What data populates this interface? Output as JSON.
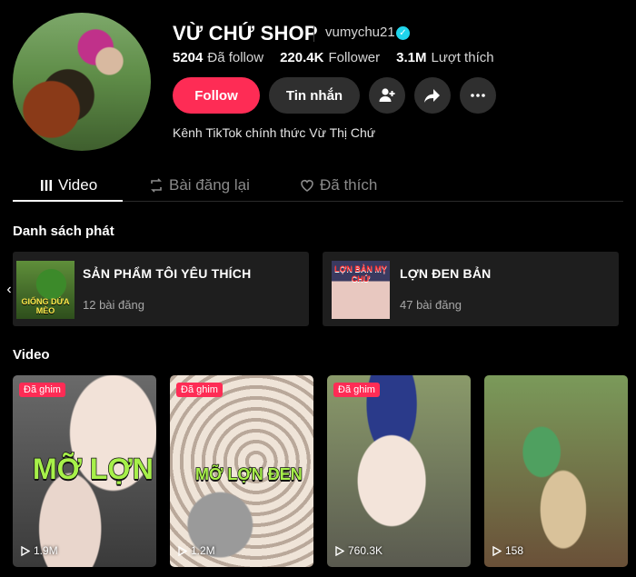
{
  "profile": {
    "username": "VỪ CHỨ SHOP",
    "handle": "vumychu21",
    "stats": [
      {
        "value": "5204",
        "label": "Đã follow"
      },
      {
        "value": "220.4K",
        "label": "Follower"
      },
      {
        "value": "3.1M",
        "label": "Lượt thích"
      }
    ],
    "follow_label": "Follow",
    "message_label": "Tin nhắn",
    "bio": "Kênh TikTok chính thức Vừ Thị Chứ"
  },
  "tabs": [
    {
      "label": "Video",
      "icon": "grid-icon"
    },
    {
      "label": "Bài đăng lại",
      "icon": "repost-icon"
    },
    {
      "label": "Đã thích",
      "icon": "liked-heart-icon"
    }
  ],
  "playlists_section": {
    "title": "Danh sách phát",
    "items": [
      {
        "title": "SẢN PHẨM TÔI YÊU THÍCH",
        "count": "12 bài đăng",
        "thumb_text": "GIỐNG DỨA MÈO"
      },
      {
        "title": "LỢN ĐEN BẢN",
        "count": "47 bài đăng",
        "thumb_text": "LỢN BẢN MỴ CHỨ"
      }
    ]
  },
  "videos_section": {
    "title": "Video",
    "items": [
      {
        "pinned": "Đã ghim",
        "views": "1.9M",
        "overlay": "MỠ LỢN"
      },
      {
        "pinned": "Đã ghim",
        "views": "1.2M",
        "overlay": "MỠ LỢN ĐEN"
      },
      {
        "pinned": "Đã ghim",
        "views": "760.3K",
        "overlay": ""
      },
      {
        "pinned": "",
        "views": "158",
        "overlay": ""
      }
    ]
  },
  "colors": {
    "accent": "#fe2c55",
    "verified": "#20d5ec",
    "background": "#000000"
  }
}
